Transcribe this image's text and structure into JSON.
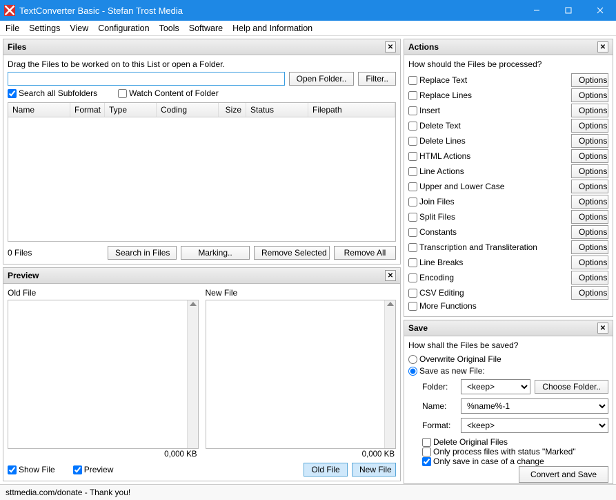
{
  "title": "TextConverter Basic - Stefan Trost Media",
  "menu": [
    "File",
    "Settings",
    "View",
    "Configuration",
    "Tools",
    "Software",
    "Help and Information"
  ],
  "files": {
    "head": "Files",
    "hint": "Drag the Files to be worked on to this List or open a Folder.",
    "open_folder": "Open Folder..",
    "filter": "Filter..",
    "search_subfolders": "Search all Subfolders",
    "watch_folder": "Watch Content of Folder",
    "cols": [
      "Name",
      "Format",
      "Type",
      "Coding",
      "Size",
      "Status",
      "Filepath"
    ],
    "count": "0 Files",
    "search": "Search in Files",
    "marking": "Marking..",
    "remove_sel": "Remove Selected",
    "remove_all": "Remove All"
  },
  "preview": {
    "head": "Preview",
    "old": "Old File",
    "new": "New File",
    "kb": "0,000 KB",
    "show_file": "Show File",
    "preview_cb": "Preview",
    "old_btn": "Old File",
    "new_btn": "New File"
  },
  "actions": {
    "head": "Actions",
    "q": "How should the Files be processed?",
    "items": [
      "Replace Text",
      "Replace Lines",
      "Insert",
      "Delete Text",
      "Delete Lines",
      "HTML Actions",
      "Line Actions",
      "Upper and Lower Case",
      "Join Files",
      "Split Files",
      "Constants",
      "Transcription and Transliteration",
      "Line Breaks",
      "Encoding",
      "CSV Editing",
      "More Functions"
    ],
    "options": "Options"
  },
  "save": {
    "head": "Save",
    "q": "How shall the Files be saved?",
    "overwrite": "Overwrite Original File",
    "as_new": "Save as new File:",
    "folder_lbl": "Folder:",
    "folder_val": "<keep>",
    "choose": "Choose Folder..",
    "name_lbl": "Name:",
    "name_val": "%name%-1",
    "format_lbl": "Format:",
    "format_val": "<keep>",
    "del_orig": "Delete Original Files",
    "only_marked": "Only process files with status \"Marked\"",
    "only_change": "Only save in case of a change",
    "convert": "Convert and Save"
  },
  "status": "sttmedia.com/donate - Thank you!"
}
